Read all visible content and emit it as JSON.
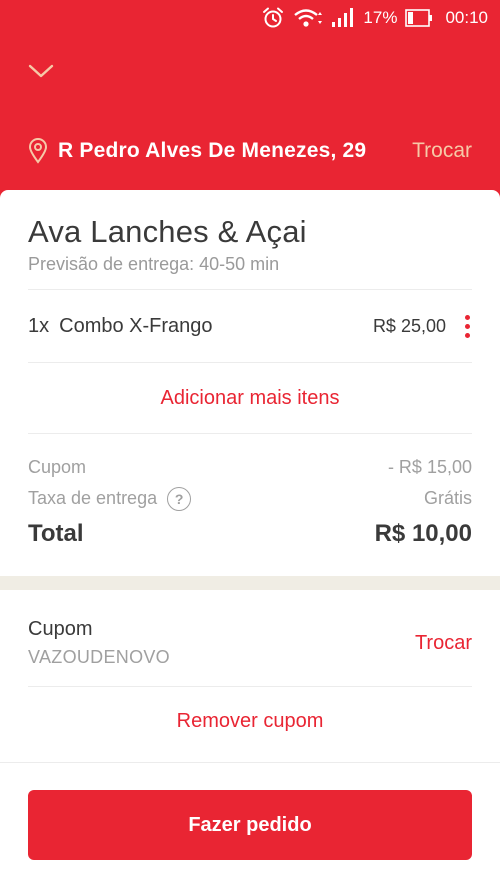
{
  "status_bar": {
    "battery_percent": "17%",
    "time": "00:10",
    "icons": [
      "alarm-icon",
      "wifi-icon",
      "signal-icon",
      "battery-icon"
    ]
  },
  "header": {
    "collapse_icon": "chevron-down-icon",
    "address": "R Pedro Alves De Menezes, 29",
    "change_address_label": "Trocar",
    "address_icon": "location-pin-icon"
  },
  "store": {
    "name": "Ava Lanches & Açai",
    "delivery_estimate": "Previsão de entrega: 40-50 min"
  },
  "cart": {
    "items": [
      {
        "quantity": "1x",
        "name": "Combo X-Frango",
        "price": "R$ 25,00"
      }
    ],
    "add_more_label": "Adicionar mais itens"
  },
  "summary": {
    "coupon_label": "Cupom",
    "coupon_value": "- R$ 15,00",
    "delivery_fee_label": "Taxa de entrega",
    "delivery_fee_value": "Grátis",
    "help_glyph": "?",
    "total_label": "Total",
    "total_value": "R$ 10,00"
  },
  "coupon": {
    "title": "Cupom",
    "code": "VAZOUDENOVO",
    "change_label": "Trocar",
    "remove_label": "Remover cupom"
  },
  "footer": {
    "place_order_label": "Fazer pedido"
  },
  "colors": {
    "brand_red": "#e92533",
    "address_action": "#f6c9a7",
    "separator_band": "#f0ede4"
  }
}
